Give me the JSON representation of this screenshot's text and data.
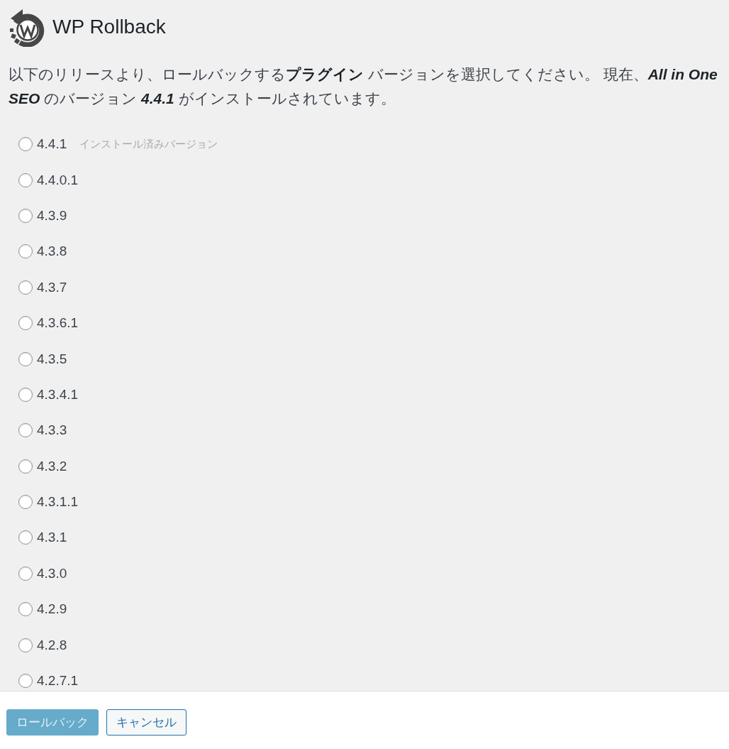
{
  "header": {
    "title": "WP Rollback"
  },
  "description": "以下のリリースより、ロールバックする**プラグイン** バージョンを選択してください。 現在、*All in One SEO* のバージョン *4.4.1* がインストールされています。",
  "versions": [
    {
      "version": "4.4.1",
      "selected": false,
      "note": "インストール済みバージョン"
    },
    {
      "version": "4.4.0.1",
      "selected": false
    },
    {
      "version": "4.3.9",
      "selected": false
    },
    {
      "version": "4.3.8",
      "selected": false
    },
    {
      "version": "4.3.7",
      "selected": false
    },
    {
      "version": "4.3.6.1",
      "selected": false
    },
    {
      "version": "4.3.5",
      "selected": false
    },
    {
      "version": "4.3.4.1",
      "selected": false
    },
    {
      "version": "4.3.3",
      "selected": false
    },
    {
      "version": "4.3.2",
      "selected": false
    },
    {
      "version": "4.3.1.1",
      "selected": false
    },
    {
      "version": "4.3.1",
      "selected": false
    },
    {
      "version": "4.3.0",
      "selected": false
    },
    {
      "version": "4.2.9",
      "selected": false
    },
    {
      "version": "4.2.8",
      "selected": false
    },
    {
      "version": "4.2.7.1",
      "selected": false
    }
  ],
  "buttons": [
    {
      "label": "ロールバック",
      "kind": "primary",
      "disabled": true
    },
    {
      "label": "キャンセル",
      "kind": "secondary",
      "disabled": false
    }
  ]
}
